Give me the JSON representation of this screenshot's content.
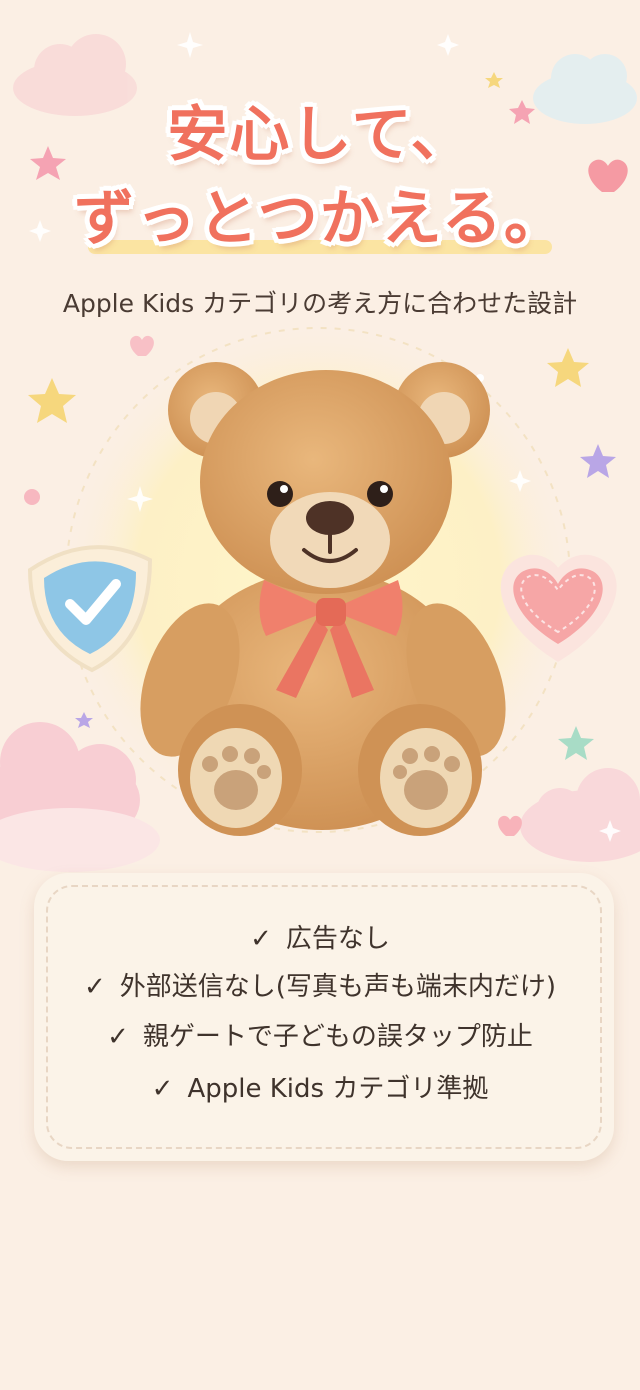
{
  "headline": {
    "line1": "安心して、",
    "line2": "ずっとつかえる。"
  },
  "subtitle": "Apple Kids カテゴリの考え方に合わせた設計",
  "features": [
    {
      "check": "✓",
      "text": "広告なし"
    },
    {
      "check": "✓",
      "text": "外部送信なし(写真も声も端末内だけ)"
    },
    {
      "check": "✓",
      "text": "親ゲートで子どもの誤タップ防止"
    },
    {
      "check": "✓",
      "text": "Apple Kids カテゴリ準拠"
    }
  ],
  "illustration": {
    "main": "teddy-bear-icon",
    "shield": "shield-check-icon",
    "heart": "heart-icon",
    "decor": [
      "star-icon",
      "cloud-icon",
      "sparkle-icon"
    ]
  },
  "colors": {
    "accent": "#f0715e",
    "background": "#fbefe4",
    "text": "#3f332c"
  }
}
